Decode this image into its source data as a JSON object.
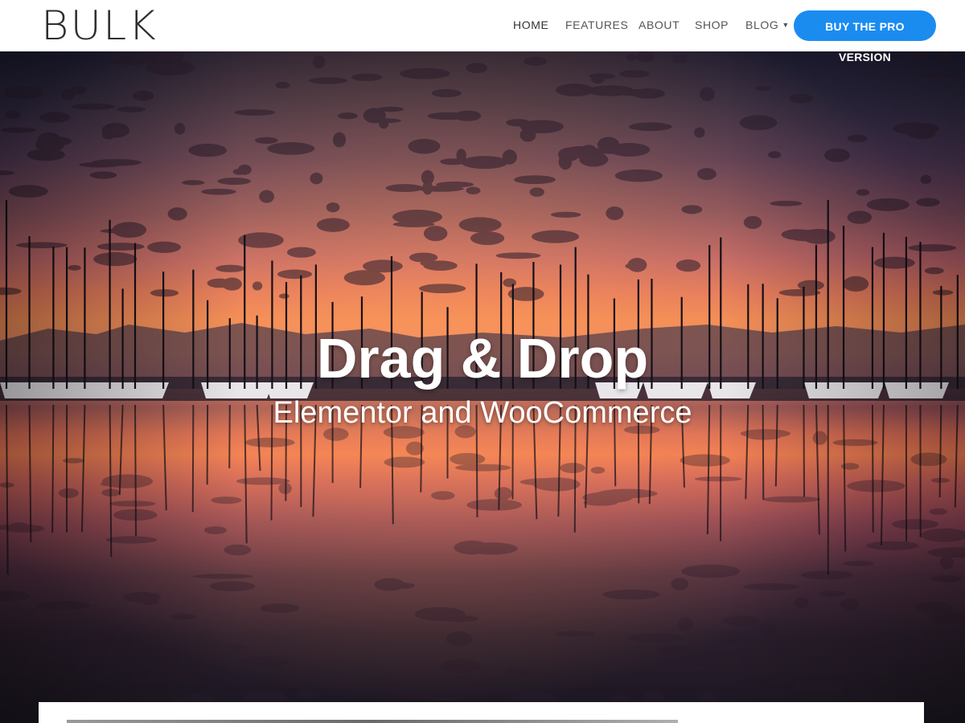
{
  "header": {
    "logo_text": "BULK",
    "nav": [
      {
        "label": "HOME",
        "active": true
      },
      {
        "label": "FEATURES",
        "active": false
      },
      {
        "label": "ABOUT",
        "active": false
      },
      {
        "label": "SHOP",
        "active": false
      },
      {
        "label": "BLOG",
        "active": false,
        "has_dropdown": true
      }
    ],
    "cta_label": "BUY THE PRO VERSION"
  },
  "hero": {
    "title": "Drag & Drop",
    "subtitle": "Elementor and WooCommerce",
    "image": "sunset-marina-with-sailboats"
  },
  "colors": {
    "accent": "#1a8cf0",
    "nav_text": "#555555",
    "logo": "#2f2f2f"
  }
}
